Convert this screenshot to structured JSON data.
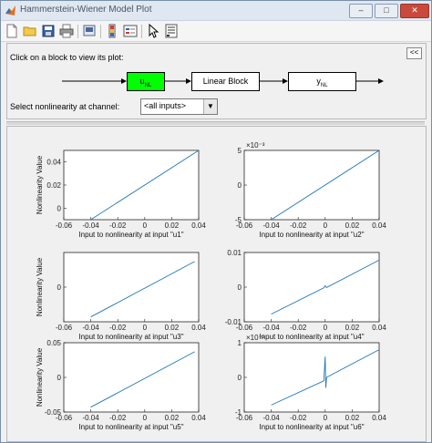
{
  "window": {
    "title": "Hammerstein-Wiener Model Plot",
    "min": "–",
    "max": "□",
    "close": "✕"
  },
  "toolbar": {
    "icons": [
      "new-file-icon",
      "open-folder-icon",
      "save-icon",
      "print-icon",
      "print-preview-icon",
      "colorbar-icon",
      "legend-icon",
      "pointer-icon",
      "property-editor-icon"
    ]
  },
  "panel": {
    "instruction": "Click on a block to view its plot:",
    "collapse_label": "<<",
    "blocks": {
      "input_nl": "u",
      "input_nl_sub": "NL",
      "linear": "Linear Block",
      "output_nl": "y",
      "output_nl_sub": "NL"
    },
    "channel_label": "Select nonlinearity at channel:",
    "channel_value": "<all inputs>"
  },
  "colors": {
    "active_block": "#00ff00",
    "line": "#1f77b4"
  },
  "chart_data": [
    {
      "type": "line",
      "xlabel": "Input to nonlinearity at input \"u1\"",
      "ylabel": "Nonlinearity Value",
      "xlim": [
        -0.06,
        0.04
      ],
      "ylim": [
        -0.01,
        0.05
      ],
      "xticks": [
        "-0.06",
        "-0.04",
        "-0.02",
        "0",
        "0.02",
        "0.04"
      ],
      "yticks": [
        "0",
        "0.02",
        "0.04"
      ],
      "exponent": "",
      "series": [
        {
          "x": [
            -0.04,
            0.04
          ],
          "y": [
            -0.01,
            0.05
          ]
        }
      ]
    },
    {
      "type": "line",
      "xlabel": "Input to nonlinearity at input \"u2\"",
      "ylabel": "",
      "xlim": [
        -0.06,
        0.04
      ],
      "ylim": [
        -5,
        5
      ],
      "xticks": [
        "-0.06",
        "-0.04",
        "-0.02",
        "0",
        "0.02",
        "0.04"
      ],
      "yticks": [
        "-5",
        "0",
        "5"
      ],
      "exponent": "×10⁻³",
      "series": [
        {
          "x": [
            -0.04,
            0.04
          ],
          "y": [
            -5,
            5
          ]
        }
      ]
    },
    {
      "type": "line",
      "xlabel": "Input to nonlinearity at input \"u3\"",
      "ylabel": "Nonlinearity Value",
      "xlim": [
        -0.06,
        0.04
      ],
      "ylim": [
        -0.05,
        0.05
      ],
      "xticks": [
        "-0.06",
        "-0.04",
        "-0.02",
        "0",
        "0.02",
        "0.04"
      ],
      "yticks": [
        "0"
      ],
      "exponent": "",
      "series": [
        {
          "x": [
            -0.04,
            0.037
          ],
          "y": [
            -0.043,
            0.037
          ]
        }
      ]
    },
    {
      "type": "line",
      "xlabel": "Input to nonlinearity at input \"u4\"",
      "ylabel": "",
      "xlim": [
        -0.06,
        0.04
      ],
      "ylim": [
        -0.01,
        0.01
      ],
      "xticks": [
        "-0.06",
        "-0.04",
        "-0.02",
        "0",
        "0.02",
        "0.04"
      ],
      "yticks": [
        "-0.01",
        "0",
        "0.01"
      ],
      "exponent": "",
      "series": [
        {
          "x": [
            -0.04,
            -0.001,
            0,
            0.001,
            0.04
          ],
          "y": [
            -0.0078,
            -0.0002,
            0.0004,
            -0.0001,
            0.0078
          ]
        }
      ]
    },
    {
      "type": "line",
      "xlabel": "Input to nonlinearity at input \"u5\"",
      "ylabel": "Nonlinearity Value",
      "xlim": [
        -0.06,
        0.04
      ],
      "ylim": [
        -0.05,
        0.05
      ],
      "xticks": [
        "-0.06",
        "-0.04",
        "-0.02",
        "0",
        "0.02",
        "0.04"
      ],
      "yticks": [
        "-0.05",
        "0",
        "0.05"
      ],
      "exponent": "",
      "series": [
        {
          "x": [
            -0.04,
            0.037
          ],
          "y": [
            -0.043,
            0.037
          ]
        }
      ]
    },
    {
      "type": "line",
      "xlabel": "Input to nonlinearity at input \"u6\"",
      "ylabel": "",
      "xlim": [
        -0.06,
        0.04
      ],
      "ylim": [
        -1,
        1
      ],
      "xticks": [
        "-0.06",
        "-0.04",
        "-0.02",
        "0",
        "0.02",
        "0.04"
      ],
      "yticks": [
        "-1",
        "0",
        "1"
      ],
      "exponent": "×10⁻³",
      "series": [
        {
          "x": [
            -0.04,
            -0.001,
            0,
            0.0005,
            0.001,
            0.04
          ],
          "y": [
            -0.8,
            -0.1,
            0.6,
            -0.3,
            0.0,
            0.8
          ]
        }
      ]
    }
  ]
}
